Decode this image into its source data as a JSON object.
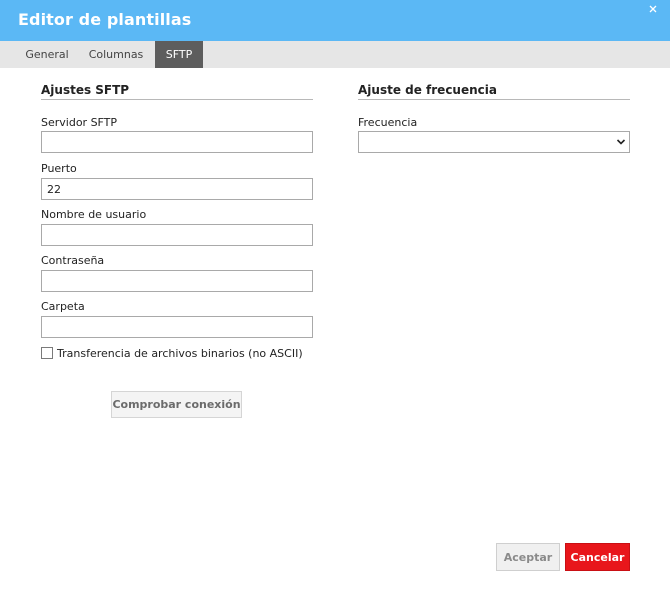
{
  "dialog": {
    "title": "Editor de plantillas"
  },
  "tabs": [
    {
      "label": "General",
      "active": false
    },
    {
      "label": "Columnas",
      "active": false
    },
    {
      "label": "SFTP",
      "active": true
    }
  ],
  "sftp": {
    "heading": "Ajustes SFTP",
    "server_label": "Servidor SFTP",
    "server_value": "",
    "port_label": "Puerto",
    "port_value": "22",
    "username_label": "Nombre de usuario",
    "username_value": "",
    "password_label": "Contraseña",
    "password_value": "",
    "folder_label": "Carpeta",
    "folder_value": "",
    "binary_label": "Transferencia de archivos binarios (no ASCII)",
    "binary_checked": false,
    "test_button": "Comprobar conexión"
  },
  "frequency": {
    "heading": "Ajuste de frecuencia",
    "label": "Frecuencia",
    "selected": ""
  },
  "footer": {
    "accept_label": "Aceptar",
    "cancel_label": "Cancelar"
  },
  "colors": {
    "titlebar": "#5bb8f5",
    "active_tab": "#5d5d5d",
    "cancel": "#e8161b"
  },
  "icons": {
    "close": "close-icon",
    "dropdown": "chevron-down-icon"
  }
}
